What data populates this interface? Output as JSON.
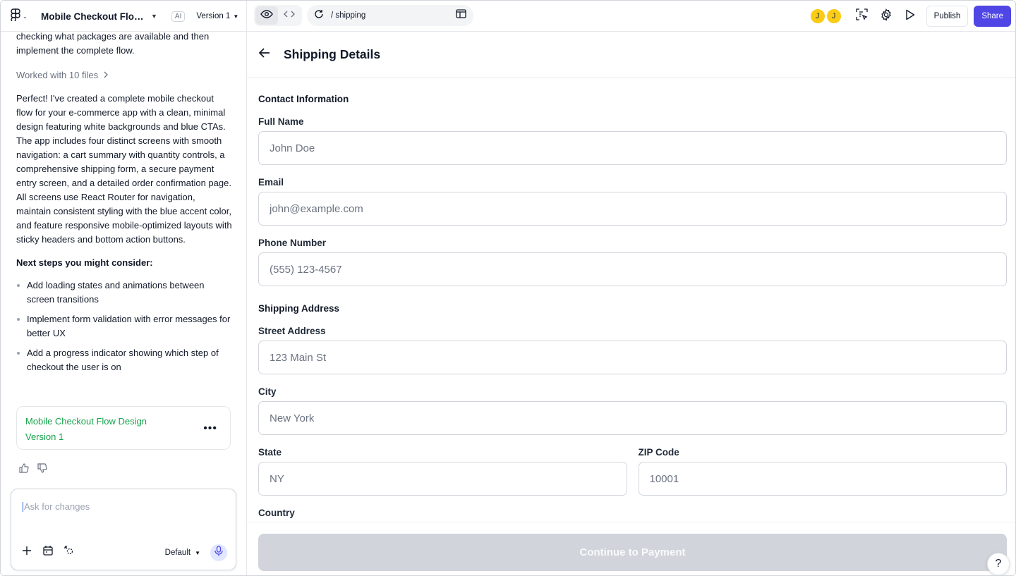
{
  "topbar": {
    "project_title": "Mobile Checkout Flow ...",
    "ai_badge": "AI",
    "version_label": "Version 1",
    "url_path": "/ shipping",
    "avatars": [
      "J",
      "J"
    ],
    "publish_label": "Publish",
    "share_label": "Share"
  },
  "chat": {
    "intro_text": "checking what packages are available and then implement the complete flow.",
    "worked_label": "Worked with 10 files",
    "summary": "Perfect! I've created a complete mobile checkout flow for your e-commerce app with a clean, minimal design featuring white backgrounds and blue CTAs. The app includes four distinct screens with smooth navigation: a cart summary with quantity controls, a comprehensive shipping form, a secure payment entry screen, and a detailed order confirmation page. All screens use React Router for navigation, maintain consistent styling with the blue accent color, and feature responsive mobile-optimized layouts with sticky headers and bottom action buttons.",
    "next_steps_heading": "Next steps you might consider:",
    "next_steps": [
      "Add loading states and animations between screen transitions",
      "Implement form validation with error messages for better UX",
      "Add a progress indicator showing which step of checkout the user is on"
    ],
    "version_card": {
      "title": "Mobile Checkout Flow Design",
      "subtitle": "Version 1"
    },
    "composer": {
      "placeholder": "Ask for changes",
      "model": "Default"
    }
  },
  "preview": {
    "page_title": "Shipping Details",
    "contact_section": "Contact Information",
    "full_name_label": "Full Name",
    "full_name_placeholder": "John Doe",
    "email_label": "Email",
    "email_placeholder": "john@example.com",
    "phone_label": "Phone Number",
    "phone_placeholder": "(555) 123-4567",
    "address_section": "Shipping Address",
    "street_label": "Street Address",
    "street_placeholder": "123 Main St",
    "city_label": "City",
    "city_placeholder": "New York",
    "state_label": "State",
    "state_placeholder": "NY",
    "zip_label": "ZIP Code",
    "zip_placeholder": "10001",
    "country_label": "Country",
    "continue_label": "Continue to Payment"
  },
  "help_label": "?",
  "colors": {
    "accent": "#4f46e5",
    "version_link": "#16a34a",
    "avatar": "#facc15",
    "disabled_button": "#d1d5db"
  },
  "icons": [
    "figma-logo-icon",
    "chevron-down-icon",
    "eye-icon",
    "code-icon",
    "refresh-icon",
    "new-tab-icon",
    "inspect-icon",
    "gear-icon",
    "play-icon",
    "chevron-right-icon",
    "thumbs-up-icon",
    "thumbs-down-icon",
    "plus-icon",
    "calendar-icon",
    "sparkle-icon",
    "microphone-icon",
    "back-arrow-icon"
  ]
}
